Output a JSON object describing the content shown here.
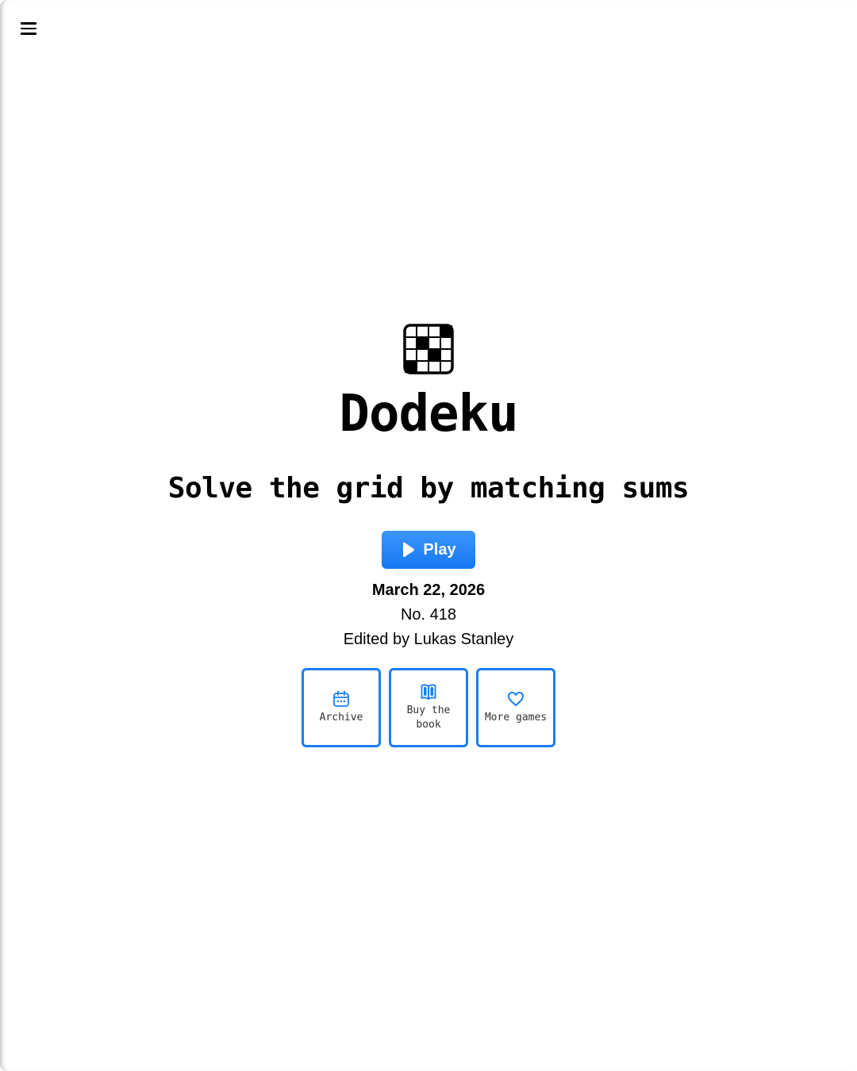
{
  "header": {
    "menu_icon": "hamburger-menu-icon"
  },
  "hero": {
    "logo_icon": "grid-puzzle-icon",
    "title": "Dodeku",
    "subtitle": "Solve the grid by matching sums"
  },
  "play": {
    "label": "Play",
    "icon": "play-icon",
    "color": "#1a7ef2"
  },
  "puzzle_info": {
    "date": "March 22, 2026",
    "number": "No. 418",
    "editor": "Edited by Lukas Stanley"
  },
  "tiles": [
    {
      "label": "Archive",
      "icon": "calendar-icon"
    },
    {
      "label": "Buy the book",
      "icon": "book-icon"
    },
    {
      "label": "More games",
      "icon": "heart-icon"
    }
  ],
  "colors": {
    "accent": "#1a7ef2",
    "text": "#000000",
    "background": "#ffffff"
  }
}
